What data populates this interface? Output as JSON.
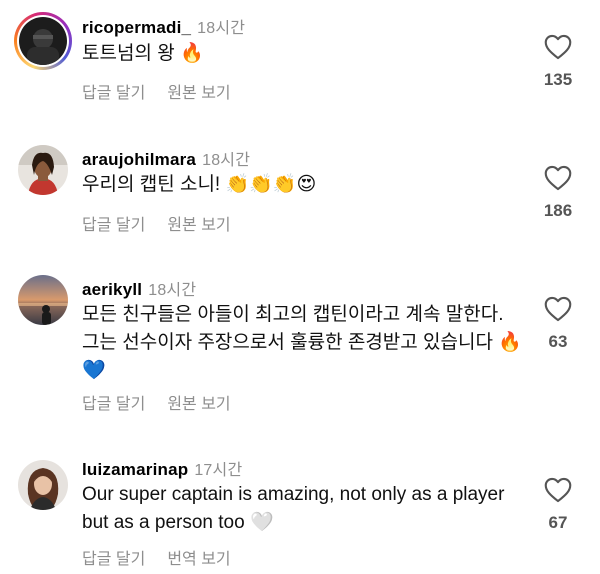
{
  "comments": [
    {
      "username": "ricopermadi_",
      "time": "18시간",
      "text": "토트넘의 왕 🔥",
      "reply_label": "답글 달기",
      "secondary_label": "원본 보기",
      "likes": "135",
      "has_story_ring": true
    },
    {
      "username": "araujohilmara",
      "time": "18시간",
      "text": "우리의 캡틴 소니! 👏👏👏😍",
      "reply_label": "답글 달기",
      "secondary_label": "원본 보기",
      "likes": "186",
      "has_story_ring": false
    },
    {
      "username": "aerikyll",
      "time": "18시간",
      "text": "모든 친구들은 아들이 최고의 캡틴이라고 계속 말한다. 그는 선수이자 주장으로서 훌륭한 존경받고 있습니다 🔥💙",
      "reply_label": "답글 달기",
      "secondary_label": "원본 보기",
      "likes": "63",
      "has_story_ring": false
    },
    {
      "username": "luizamarinap",
      "time": "17시간",
      "text": "Our super captain is amazing, not only as a player but as a person too 🤍",
      "reply_label": "답글 달기",
      "secondary_label": "번역 보기",
      "likes": "67",
      "has_story_ring": false
    }
  ],
  "icons": {
    "like": "heart-outline-icon"
  },
  "colors": {
    "muted_text": "#8e8e8e",
    "story_ring": [
      "#feda75",
      "#fa7e1e",
      "#d62976",
      "#962fbf",
      "#4f5bd5"
    ]
  }
}
